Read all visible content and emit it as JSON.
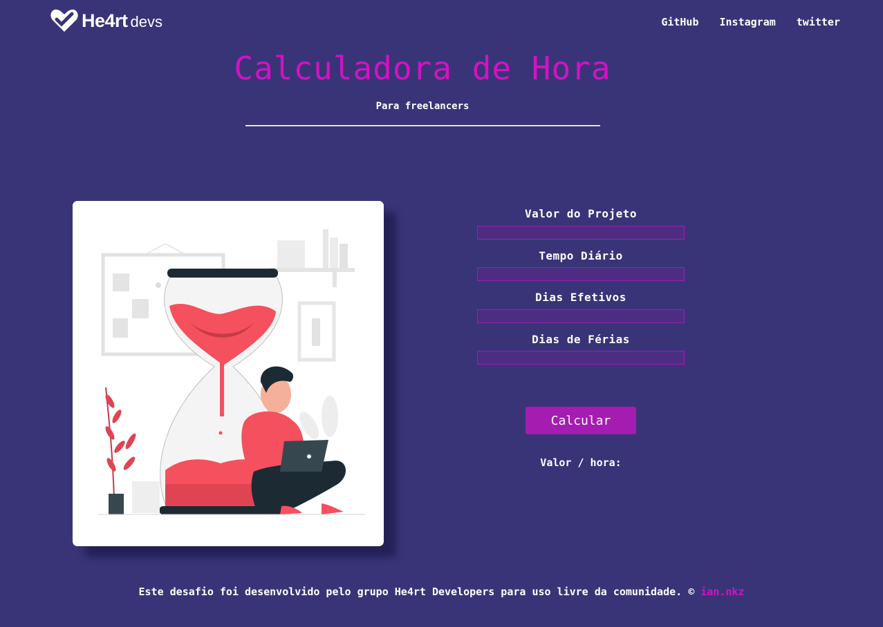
{
  "header": {
    "logo_text": "He4rt",
    "logo_sub": "devs",
    "nav": [
      "GitHub",
      "Instagram",
      "twitter"
    ]
  },
  "hero": {
    "title": "Calculadora de Hora",
    "subtitle": "Para freelancers"
  },
  "form": {
    "fields": [
      {
        "label": "Valor do Projeto",
        "value": ""
      },
      {
        "label": "Tempo Diário",
        "value": ""
      },
      {
        "label": "Dias Efetivos",
        "value": ""
      },
      {
        "label": "Dias de Férias",
        "value": ""
      }
    ],
    "button_label": "Calcular",
    "result_label": "Valor / hora:"
  },
  "footer": {
    "text": "Este desafio foi desenvolvido pelo grupo He4rt Developers para uso livre da comunidade. © ",
    "author": "ian.nkz"
  },
  "colors": {
    "background": "#393478",
    "accent": "#d511c3",
    "button": "#a51cb1",
    "illustration_red": "#f5505d"
  }
}
